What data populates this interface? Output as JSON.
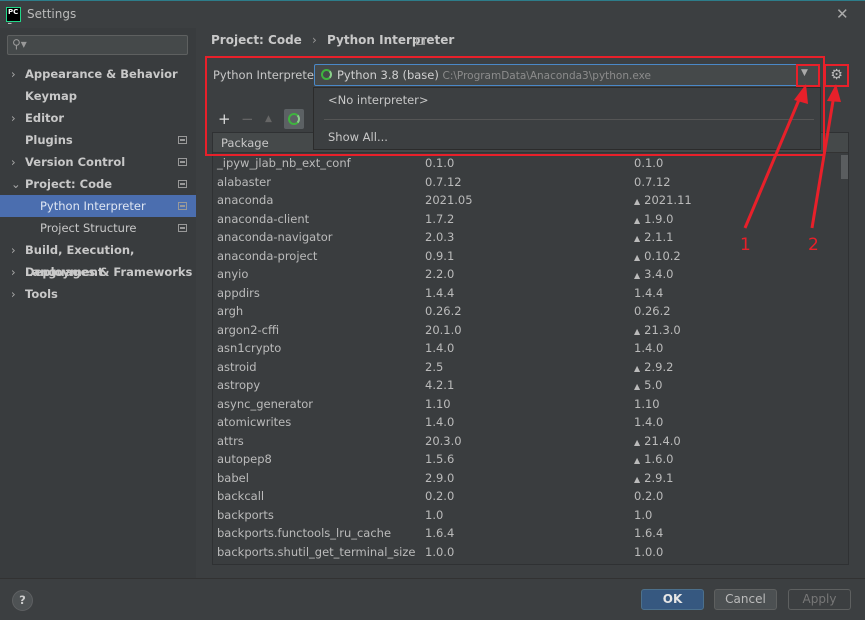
{
  "window": {
    "title": "Settings",
    "logo": "PC",
    "close_icon": "close-icon"
  },
  "sidebar": {
    "search_placeholder": "",
    "items": [
      {
        "label": "Appearance & Behavior",
        "chev": "›",
        "level": 0,
        "icon": false
      },
      {
        "label": "Keymap",
        "chev": "",
        "level": 0,
        "icon": false
      },
      {
        "label": "Editor",
        "chev": "›",
        "level": 0,
        "icon": false
      },
      {
        "label": "Plugins",
        "chev": "",
        "level": 0,
        "icon": true
      },
      {
        "label": "Version Control",
        "chev": "›",
        "level": 0,
        "icon": true
      },
      {
        "label": "Project: Code",
        "chev": "⌄",
        "level": 0,
        "icon": true
      },
      {
        "label": "Python Interpreter",
        "chev": "",
        "level": 1,
        "icon": true,
        "selected": true
      },
      {
        "label": "Project Structure",
        "chev": "",
        "level": 1,
        "icon": true
      },
      {
        "label": "Build, Execution, Deployment",
        "chev": "›",
        "level": 0,
        "icon": false
      },
      {
        "label": "Languages & Frameworks",
        "chev": "›",
        "level": 0,
        "icon": false
      },
      {
        "label": "Tools",
        "chev": "›",
        "level": 0,
        "icon": false
      }
    ]
  },
  "breadcrumb": {
    "project": "Project: Code",
    "sep": "›",
    "page": "Python Interpreter"
  },
  "interpreter": {
    "label": "Python Interpreter:",
    "name": "Python 3.8 (base)",
    "path": "C:\\ProgramData\\Anaconda3\\python.exe"
  },
  "popup": {
    "items": [
      "<No interpreter>",
      "Show All..."
    ]
  },
  "toolbar": {
    "add": "+",
    "remove": "−",
    "upgrade": "▲"
  },
  "table": {
    "header": "Package",
    "rows": [
      [
        "_ipyw_jlab_nb_ext_conf",
        "0.1.0",
        "0.1.0",
        false
      ],
      [
        "alabaster",
        "0.7.12",
        "0.7.12",
        false
      ],
      [
        "anaconda",
        "2021.05",
        "2021.11",
        true
      ],
      [
        "anaconda-client",
        "1.7.2",
        "1.9.0",
        true
      ],
      [
        "anaconda-navigator",
        "2.0.3",
        "2.1.1",
        true
      ],
      [
        "anaconda-project",
        "0.9.1",
        "0.10.2",
        true
      ],
      [
        "anyio",
        "2.2.0",
        "3.4.0",
        true
      ],
      [
        "appdirs",
        "1.4.4",
        "1.4.4",
        false
      ],
      [
        "argh",
        "0.26.2",
        "0.26.2",
        false
      ],
      [
        "argon2-cffi",
        "20.1.0",
        "21.3.0",
        true
      ],
      [
        "asn1crypto",
        "1.4.0",
        "1.4.0",
        false
      ],
      [
        "astroid",
        "2.5",
        "2.9.2",
        true
      ],
      [
        "astropy",
        "4.2.1",
        "5.0",
        true
      ],
      [
        "async_generator",
        "1.10",
        "1.10",
        false
      ],
      [
        "atomicwrites",
        "1.4.0",
        "1.4.0",
        false
      ],
      [
        "attrs",
        "20.3.0",
        "21.4.0",
        true
      ],
      [
        "autopep8",
        "1.5.6",
        "1.6.0",
        true
      ],
      [
        "babel",
        "2.9.0",
        "2.9.1",
        true
      ],
      [
        "backcall",
        "0.2.0",
        "0.2.0",
        false
      ],
      [
        "backports",
        "1.0",
        "1.0",
        false
      ],
      [
        "backports.functools_lru_cache",
        "1.6.4",
        "1.6.4",
        false
      ],
      [
        "backports.shutil_get_terminal_size",
        "1.0.0",
        "1.0.0",
        false
      ]
    ]
  },
  "footer": {
    "help": "?",
    "ok": "OK",
    "cancel": "Cancel",
    "apply": "Apply"
  },
  "annotations": {
    "label1": "1",
    "label2": "2",
    "color": "#e8202a"
  }
}
